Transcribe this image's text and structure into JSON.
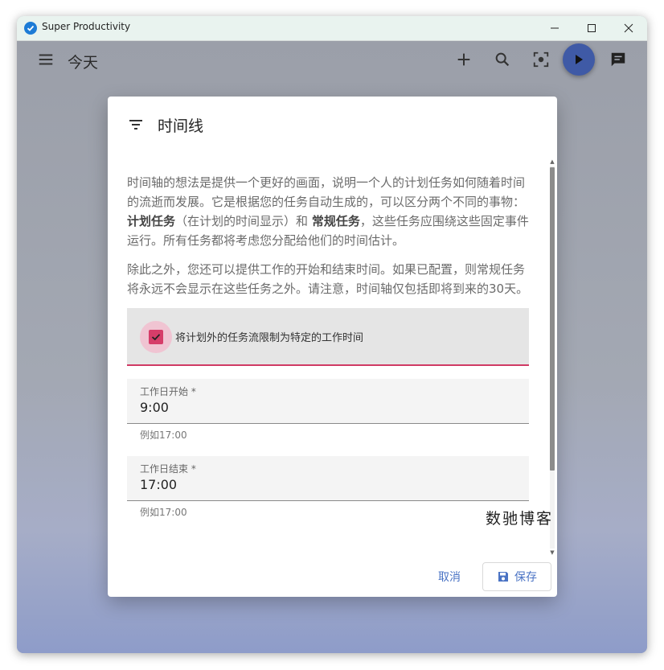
{
  "window": {
    "title": "Super Productivity",
    "controls": [
      "minimize",
      "maximize",
      "close"
    ]
  },
  "toolbar": {
    "page_title": "今天",
    "icons": [
      "menu-icon",
      "add-icon",
      "search-icon",
      "focus-icon",
      "play-icon",
      "chat-icon"
    ]
  },
  "dialog": {
    "title": "时间线",
    "paragraph1_a": "时间轴的想法是提供一个更好的画面，说明一个人的计划任务如何随着时间的流逝而发展。它是根据您的任务自动生成的，可以区分两个不同的事物：",
    "paragraph1_b1": "计划任务",
    "paragraph1_c": "（在计划的时间显示）和",
    "paragraph1_b2": "常规任务",
    "paragraph1_d": "，这些任务应围绕这些固定事件运行。所有任务都将考虑您分配给他们的时间估计。",
    "paragraph2": "除此之外，您还可以提供工作的开始和结束时间。如果已配置，则常规任务将永远不会显示在这些任务之外。请注意，时间轴仅包括即将到来的30天。",
    "checkbox_label": "将计划外的任务流限制为特定的工作时间",
    "checkbox_checked": true,
    "work_start": {
      "label": "工作日开始 *",
      "value": "9:00",
      "hint": "例如17:00"
    },
    "work_end": {
      "label": "工作日结束 *",
      "value": "17:00",
      "hint": "例如17:00"
    },
    "watermark": "数驰博客",
    "cancel_label": "取消",
    "save_label": "保存"
  },
  "colors": {
    "accent": "#d63d69",
    "primary": "#3f5aa6",
    "link": "#4a73c4"
  }
}
